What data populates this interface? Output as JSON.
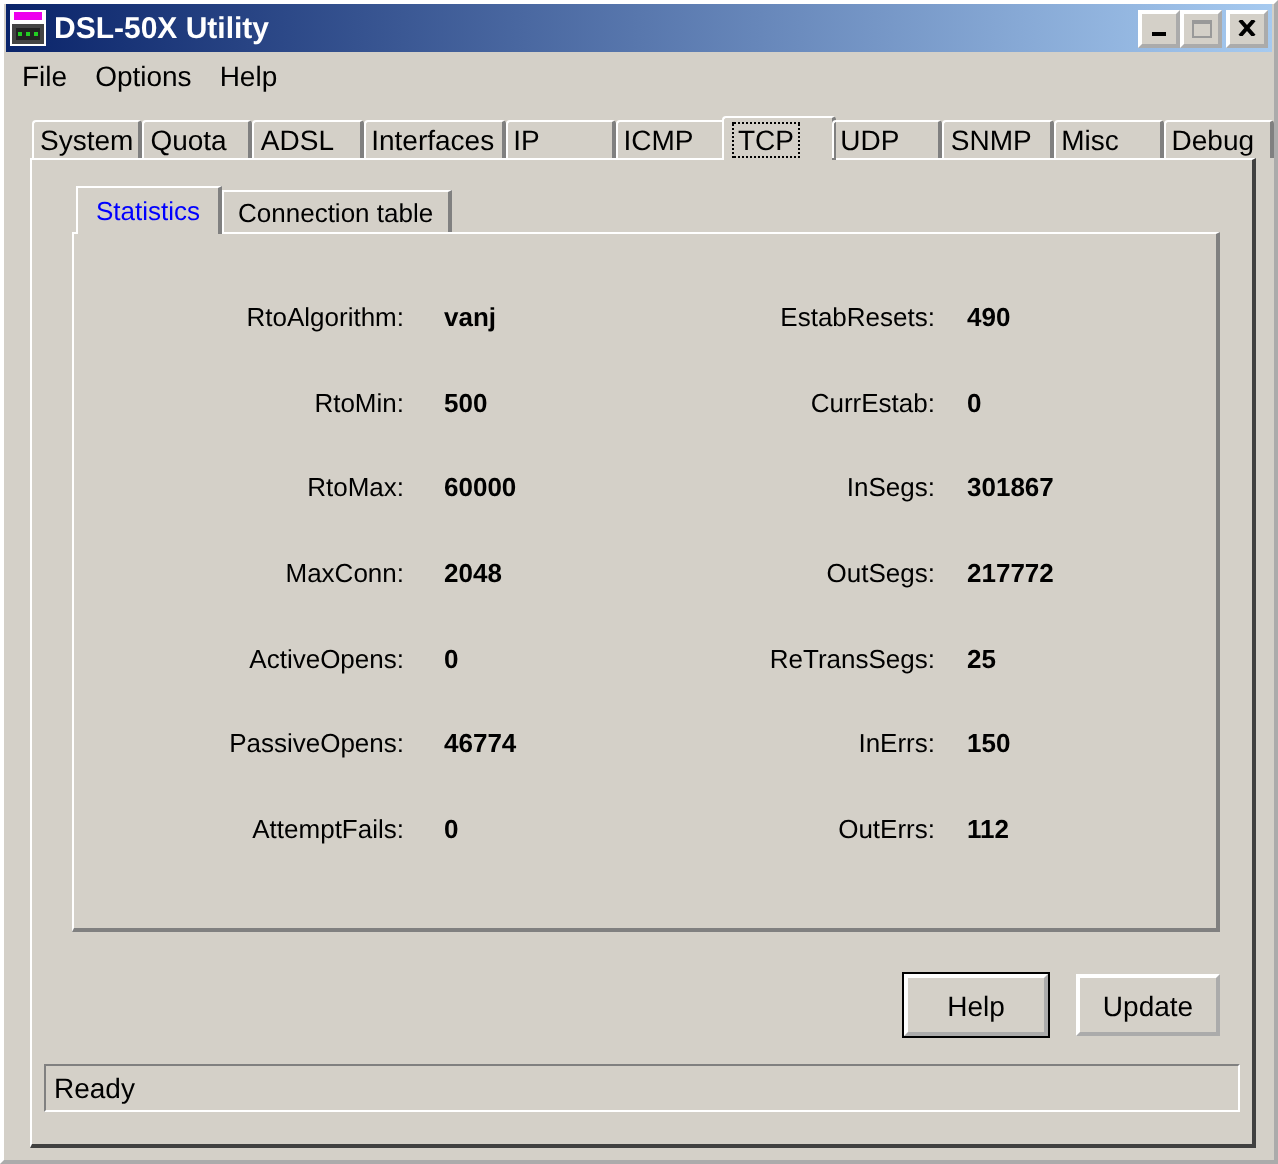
{
  "window": {
    "title": "DSL-50X Utility"
  },
  "menu": [
    "File",
    "Options",
    "Help"
  ],
  "tabs": [
    {
      "label": "System",
      "selected": false
    },
    {
      "label": "Quota",
      "selected": false
    },
    {
      "label": "ADSL",
      "selected": false
    },
    {
      "label": "Interfaces",
      "selected": false
    },
    {
      "label": "IP",
      "selected": false
    },
    {
      "label": "ICMP",
      "selected": false
    },
    {
      "label": "TCP",
      "selected": true
    },
    {
      "label": "UDP",
      "selected": false
    },
    {
      "label": "SNMP",
      "selected": false
    },
    {
      "label": "Misc",
      "selected": false
    },
    {
      "label": "Debug",
      "selected": false
    }
  ],
  "subtabs": [
    {
      "label": "Statistics",
      "selected": true
    },
    {
      "label": "Connection table",
      "selected": false
    }
  ],
  "stats_left": [
    {
      "label": "RtoAlgorithm:",
      "value": "vanj"
    },
    {
      "label": "RtoMin:",
      "value": "500"
    },
    {
      "label": "RtoMax:",
      "value": "60000"
    },
    {
      "label": "MaxConn:",
      "value": "2048"
    },
    {
      "label": "ActiveOpens:",
      "value": "0"
    },
    {
      "label": "PassiveOpens:",
      "value": "46774"
    },
    {
      "label": "AttemptFails:",
      "value": "0"
    }
  ],
  "stats_right": [
    {
      "label": "EstabResets:",
      "value": "490"
    },
    {
      "label": "CurrEstab:",
      "value": "0"
    },
    {
      "label": "InSegs:",
      "value": "301867"
    },
    {
      "label": "OutSegs:",
      "value": "217772"
    },
    {
      "label": "ReTransSegs:",
      "value": "25"
    },
    {
      "label": "InErrs:",
      "value": "150"
    },
    {
      "label": "OutErrs:",
      "value": "112"
    }
  ],
  "buttons": [
    {
      "label": "Help",
      "default": true
    },
    {
      "label": "Update",
      "default": false
    }
  ],
  "status_bar": "Ready"
}
